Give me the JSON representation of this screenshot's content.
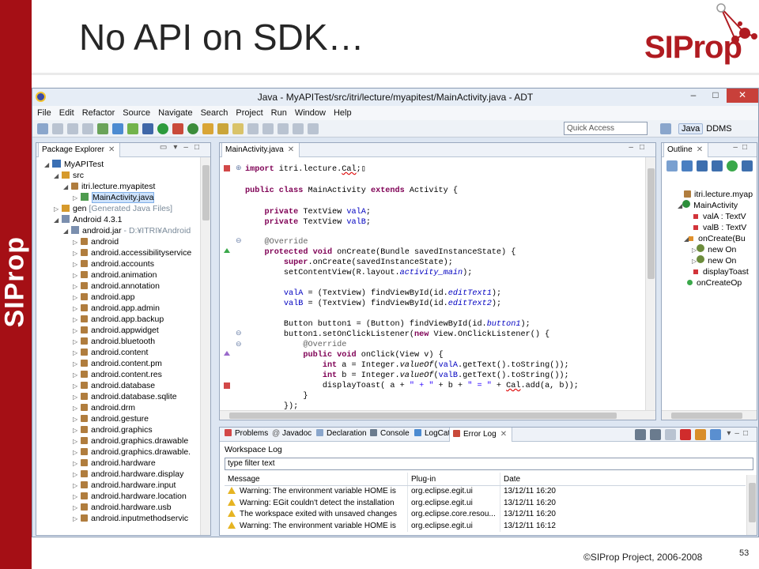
{
  "slide": {
    "title": "No API on SDK…",
    "side_text": "SIProp",
    "logo_text": "SIProp",
    "footer": "©SIProp Project, 2006-2008",
    "page_number": "53"
  },
  "ide": {
    "window_title": "Java - MyAPITest/src/itri/lecture/myapitest/MainActivity.java - ADT",
    "menu": [
      "File",
      "Edit",
      "Refactor",
      "Source",
      "Navigate",
      "Search",
      "Project",
      "Run",
      "Window",
      "Help"
    ],
    "quick_access_placeholder": "Quick Access",
    "perspectives": {
      "java": "Java",
      "ddms": "DDMS"
    },
    "package_explorer": {
      "tab": "Package Explorer",
      "items": [
        {
          "label": "MyAPITest"
        },
        {
          "label": "src"
        },
        {
          "label": "itri.lecture.myapitest"
        },
        {
          "label": "MainActivity.java"
        },
        {
          "label": "gen",
          "suffix": "[Generated Java Files]"
        },
        {
          "label": "Android 4.3.1"
        },
        {
          "label": "android.jar",
          "suffix": "- D:¥ITRI¥Android"
        },
        {
          "label": "android"
        },
        {
          "label": "android.accessibilityservice"
        },
        {
          "label": "android.accounts"
        },
        {
          "label": "android.animation"
        },
        {
          "label": "android.annotation"
        },
        {
          "label": "android.app"
        },
        {
          "label": "android.app.admin"
        },
        {
          "label": "android.app.backup"
        },
        {
          "label": "android.appwidget"
        },
        {
          "label": "android.bluetooth"
        },
        {
          "label": "android.content"
        },
        {
          "label": "android.content.pm"
        },
        {
          "label": "android.content.res"
        },
        {
          "label": "android.database"
        },
        {
          "label": "android.database.sqlite"
        },
        {
          "label": "android.drm"
        },
        {
          "label": "android.gesture"
        },
        {
          "label": "android.graphics"
        },
        {
          "label": "android.graphics.drawable"
        },
        {
          "label": "android.graphics.drawable."
        },
        {
          "label": "android.hardware"
        },
        {
          "label": "android.hardware.display"
        },
        {
          "label": "android.hardware.input"
        },
        {
          "label": "android.hardware.location"
        },
        {
          "label": "android.hardware.usb"
        },
        {
          "label": "android.inputmethodservic"
        }
      ]
    },
    "editor": {
      "tab": "MainActivity.java"
    },
    "outline": {
      "tab": "Outline",
      "items": [
        "itri.lecture.myap",
        "MainActivity",
        "valA : TextV",
        "valB : TextV",
        "onCreate(Bu",
        "new On",
        "new On",
        "displayToast",
        "onCreateOp"
      ]
    },
    "bottom": {
      "tabs": [
        "Problems",
        "Javadoc",
        "Declaration",
        "Console",
        "LogCat",
        "Error Log"
      ],
      "section_title": "Workspace Log",
      "filter_placeholder": "type filter text",
      "columns": [
        "Message",
        "Plug-in",
        "Date"
      ],
      "rows": [
        {
          "message": "Warning: The environment variable HOME is",
          "plugin": "org.eclipse.egit.ui",
          "date": "13/12/11 16:20"
        },
        {
          "message": "Warning: EGit couldn't detect the installation",
          "plugin": "org.eclipse.egit.ui",
          "date": "13/12/11 16:20"
        },
        {
          "message": "The workspace exited with unsaved changes",
          "plugin": "org.eclipse.core.resou...",
          "date": "13/12/11 16:20"
        },
        {
          "message": "Warning: The environment variable HOME is",
          "plugin": "org.eclipse.egit.ui",
          "date": "13/12/11 16:12"
        }
      ]
    }
  }
}
